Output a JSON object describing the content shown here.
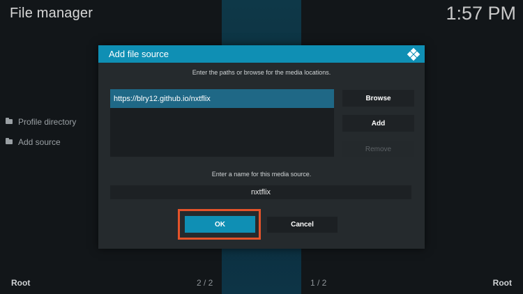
{
  "app": {
    "title": "File manager",
    "clock": "1:57 PM"
  },
  "sidebar": {
    "items": [
      {
        "label": "Profile directory",
        "icon": "folder-icon"
      },
      {
        "label": "Add source",
        "icon": "folder-icon"
      }
    ]
  },
  "footer": {
    "left_root": "Root",
    "left_page": "2 / 2",
    "right_page": "1 / 2",
    "right_root": "Root"
  },
  "dialog": {
    "title": "Add file source",
    "icon": "kodi-icon",
    "description": "Enter the paths or browse for the media locations.",
    "paths": [
      "https://blry12.github.io/nxtflix"
    ],
    "browse_label": "Browse",
    "add_label": "Add",
    "remove_label": "Remove",
    "name_prompt": "Enter a name for this media source.",
    "name_value": "nxtflix",
    "ok_label": "OK",
    "cancel_label": "Cancel"
  },
  "colors": {
    "accent": "#0f8fb4",
    "highlight": "#e4532a",
    "background": "#121619",
    "dialog_bg": "#252a2d"
  }
}
